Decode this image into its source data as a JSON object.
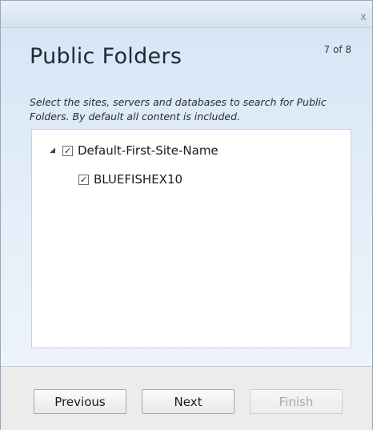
{
  "titlebar": {
    "close_glyph": "x"
  },
  "page": {
    "title": "Public Folders",
    "step": "7 of 8",
    "description": "Select the sites, servers and databases to search for Public Folders.  By default all content is included."
  },
  "tree": {
    "items": [
      {
        "label": "Default-First-Site-Name",
        "checked": true,
        "expanded": true,
        "expander_glyph": "◢"
      },
      {
        "label": "BLUEFISHEX10",
        "checked": true
      }
    ],
    "check_glyph": "✓"
  },
  "footer": {
    "previous_label": "Previous",
    "next_label": "Next",
    "finish_label": "Finish"
  }
}
